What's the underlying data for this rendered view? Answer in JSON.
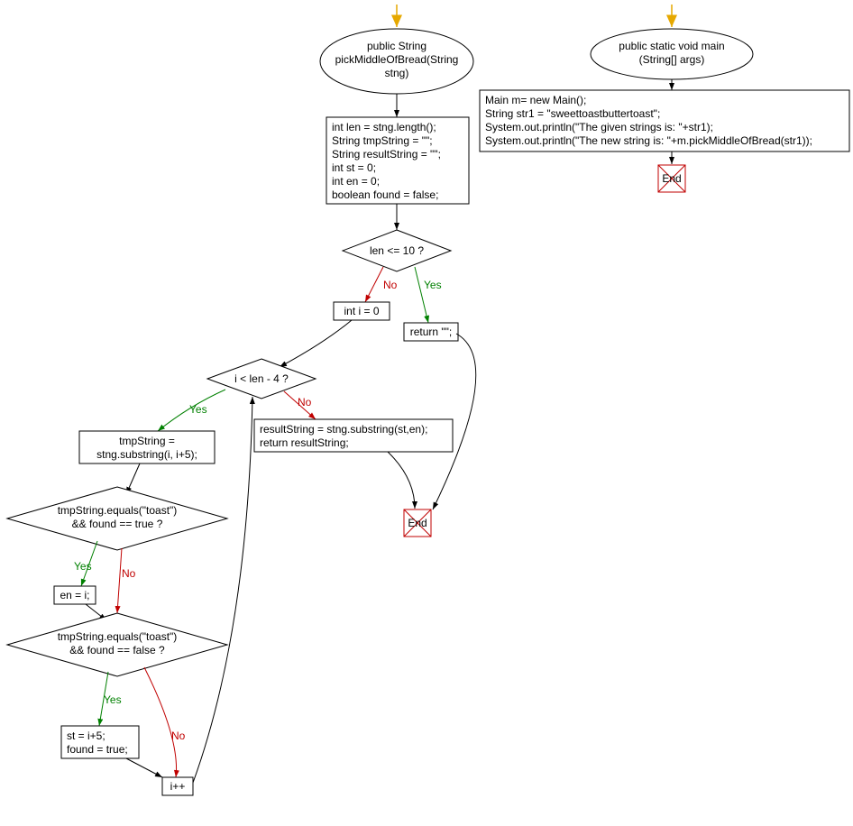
{
  "flowchart": {
    "entry1": {
      "title": "public String\npickMiddleOfBread(String\nstng)"
    },
    "entry2": {
      "title": "public static void main\n(String[] args)"
    },
    "mainBody": {
      "lines": [
        "Main m= new Main();",
        "String str1 = \"sweettoastbuttertoast\";",
        "System.out.println(\"The given strings is: \"+str1);",
        "System.out.println(\"The new string is: \"+m.pickMiddleOfBread(str1));"
      ]
    },
    "initBlock": {
      "lines": [
        "int len = stng.length();",
        "String tmpString = \"\";",
        "String resultString = \"\";",
        "int st = 0;",
        "int en = 0;",
        "boolean found = false;"
      ]
    },
    "decision1": "len <= 10 ?",
    "returnEmpty": "return \"\";",
    "initI": "int i = 0",
    "loopCond": "i < len - 4 ?",
    "tmpAssign": "tmpString =\nstng.substring(i, i+5);",
    "decision2": "tmpString.equals(\"toast\")\n&& found == true ?",
    "enAssign": "en = i;",
    "decision3": "tmpString.equals(\"toast\")\n&& found == false ?",
    "stAssign": "st = i+5;\nfound = true;",
    "increment": "i++",
    "resultBlock": "resultString = stng.substring(st,en);\nreturn resultString;",
    "end": "End",
    "labels": {
      "yes": "Yes",
      "no": "No"
    },
    "colors": {
      "yes": "#008000",
      "no": "#c00000",
      "arrow": "#e6a800",
      "line": "#000000",
      "endFill": "#ffffff",
      "endCross": "#c00000"
    }
  }
}
